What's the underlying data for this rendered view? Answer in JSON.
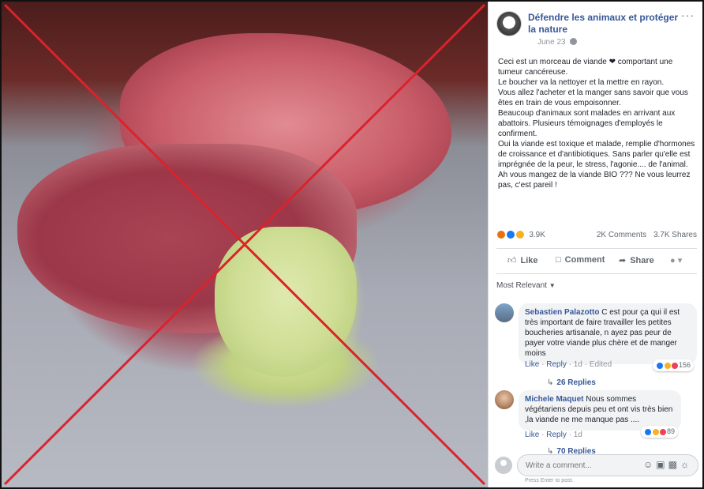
{
  "page": {
    "name": "Défendre les animaux et protéger la nature",
    "date": "June 23",
    "more_glyph": "···"
  },
  "post": {
    "text": "Ceci est un morceau de viande ❤ comportant une tumeur cancéreuse.\nLe boucher va la nettoyer et la mettre en rayon.\nVous allez l'acheter et la manger sans savoir que vous êtes en train de vous empoisonner.\nBeaucoup d'animaux sont malades en arrivant aux abattoirs. Plusieurs témoignages d'employés le confirment.\nOui la viande est toxique et malade, remplie d'hormones de croissance et d'antibiotiques. Sans parler qu'elle est imprégnée de la peur, le stress, l'agonie.... de l'animal.\nAh vous mangez de la viande BIO ??? Ne vous leurrez pas, c'est pareil !"
  },
  "stats": {
    "reactions": "3.9K",
    "comments": "2K Comments",
    "shares": "3.7K Shares"
  },
  "actions": {
    "like": "Like",
    "comment": "Comment",
    "share": "Share"
  },
  "sort": {
    "label": "Most Relevant"
  },
  "comments": [
    {
      "name": "Sebastien Palazotto",
      "text": " C est pour ça qui il est très important de faire travailler les petites boucheries artisanale, n ayez pas peur de payer votre viande plus chère et de manger moins",
      "reactions": "156",
      "like": "Like",
      "reply": "Reply",
      "time": "1d",
      "edited": "Edited",
      "replies": "26 Replies"
    },
    {
      "name": "Michele Maquet",
      "text": " Nous sommes végétariens depuis peu et ont vis très bien ,la viande ne me manque pas ....",
      "reactions": "89",
      "like": "Like",
      "reply": "Reply",
      "time": "1d",
      "replies": "70 Replies"
    }
  ],
  "composer": {
    "placeholder": "Write a comment...",
    "hint": "Press Enter to post."
  },
  "colors": {
    "link": "#385898",
    "cross": "#e0202a",
    "bubble": "#f2f3f5"
  }
}
